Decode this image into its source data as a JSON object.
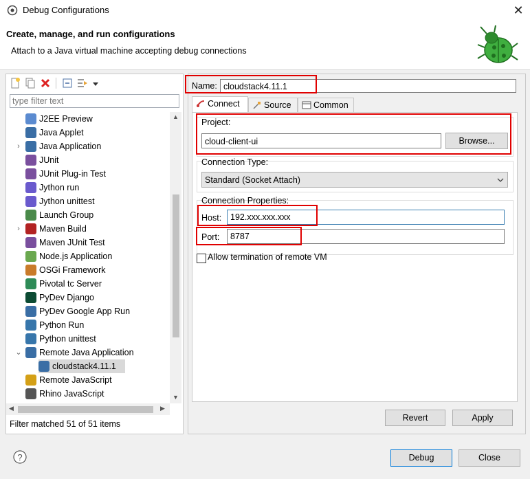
{
  "window": {
    "title": "Debug Configurations",
    "close_glyph": "✕"
  },
  "banner": {
    "heading": "Create, manage, and run configurations",
    "subheading": "Attach to a Java virtual machine accepting debug connections"
  },
  "left": {
    "filter_placeholder": "type filter text",
    "items": [
      {
        "label": "J2EE Preview",
        "icon": "j2ee-icon"
      },
      {
        "label": "Java Applet",
        "icon": "java-applet-icon"
      },
      {
        "label": "Java Application",
        "icon": "java-application-icon",
        "expander": "›"
      },
      {
        "label": "JUnit",
        "icon": "junit-icon"
      },
      {
        "label": "JUnit Plug-in Test",
        "icon": "junit-plugin-icon"
      },
      {
        "label": "Jython run",
        "icon": "jython-run-icon"
      },
      {
        "label": "Jython unittest",
        "icon": "jython-unittest-icon"
      },
      {
        "label": "Launch Group",
        "icon": "launch-group-icon"
      },
      {
        "label": "Maven Build",
        "icon": "maven-build-icon",
        "expander": "›"
      },
      {
        "label": "Maven JUnit Test",
        "icon": "maven-junit-icon"
      },
      {
        "label": "Node.js Application",
        "icon": "nodejs-icon"
      },
      {
        "label": "OSGi Framework",
        "icon": "osgi-icon"
      },
      {
        "label": "Pivotal tc Server",
        "icon": "pivotal-icon"
      },
      {
        "label": "PyDev Django",
        "icon": "pydev-django-icon"
      },
      {
        "label": "PyDev Google App Run",
        "icon": "pydev-google-icon"
      },
      {
        "label": "Python Run",
        "icon": "python-run-icon"
      },
      {
        "label": "Python unittest",
        "icon": "python-unittest-icon"
      },
      {
        "label": "Remote Java Application",
        "icon": "remote-java-icon",
        "expander": "⌄"
      },
      {
        "label": "cloudstack4.11.1",
        "icon": "launch-config-icon",
        "child": true,
        "selected": true
      },
      {
        "label": "Remote JavaScript",
        "icon": "remote-javascript-icon"
      },
      {
        "label": "Rhino JavaScript",
        "icon": "rhino-icon"
      }
    ],
    "filtered_status": "Filter matched 51 of 51 items"
  },
  "right": {
    "name_label": "Name:",
    "name_value": "cloudstack4.11.1",
    "tabs": [
      "Connect",
      "Source",
      "Common"
    ],
    "project_label": "Project:",
    "project_value": "cloud-client-ui",
    "browse_label": "Browse...",
    "conn_type_label": "Connection Type:",
    "conn_type_value": "Standard (Socket Attach)",
    "conn_props_label": "Connection Properties:",
    "host_label": "Host:",
    "host_value": "192.xxx.xxx.xxx",
    "port_label": "Port:",
    "port_value": "8787",
    "allow_termination_label": "Allow termination of remote VM",
    "revert_label": "Revert",
    "apply_label": "Apply"
  },
  "footer": {
    "debug_label": "Debug",
    "close_label": "Close"
  },
  "colors": {
    "highlight_red": "#e00000",
    "selection": "#d9d9d9"
  }
}
